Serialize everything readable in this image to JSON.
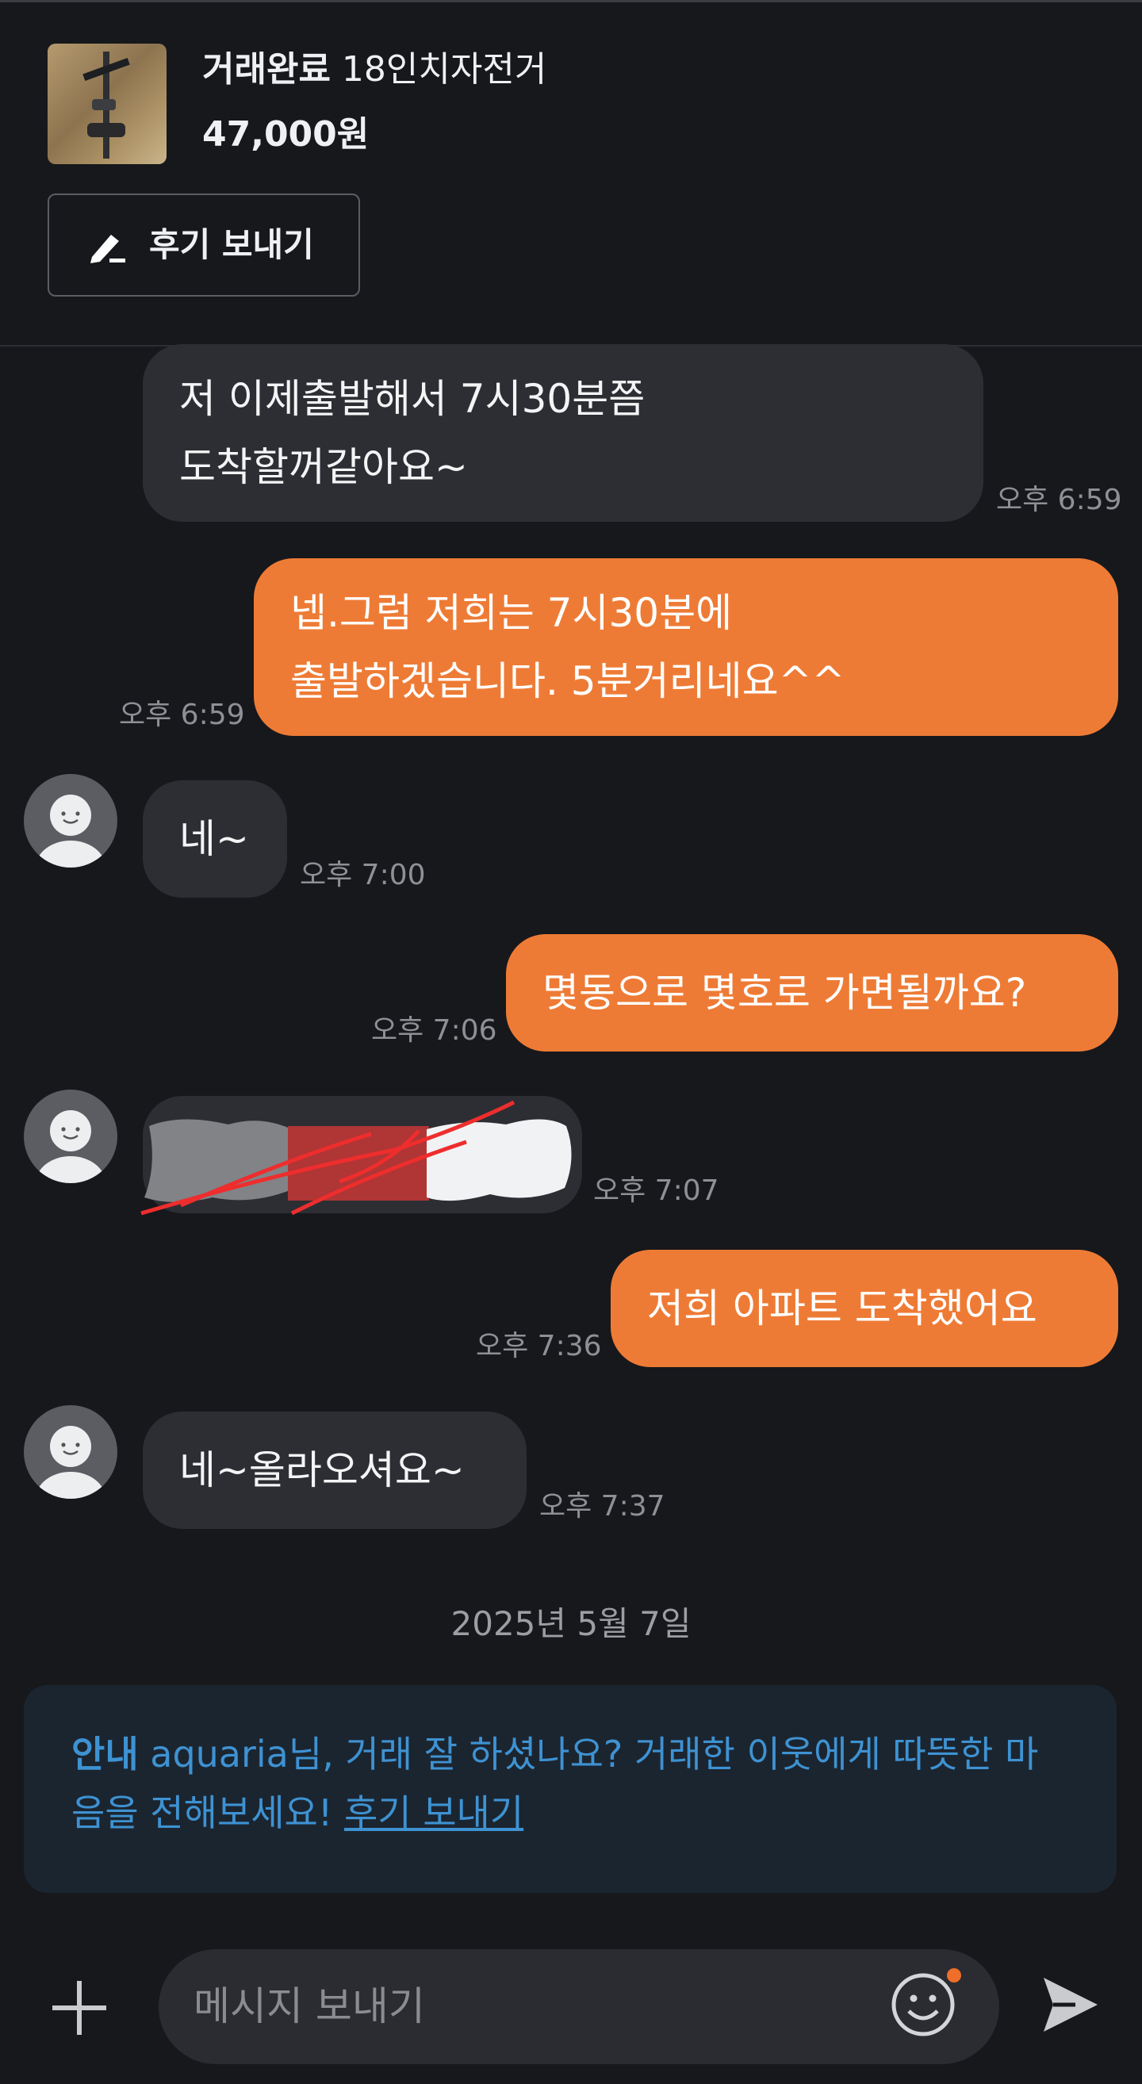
{
  "product": {
    "status": "거래완료",
    "name": "18인치자전거",
    "price": "47,000원",
    "review_button": "후기 보내기"
  },
  "messages": [
    {
      "side": "in",
      "lines": [
        "저 이제출발해서 7시30분쯤",
        "도착할꺼같아요~"
      ],
      "time": "오후 6:59"
    },
    {
      "side": "out",
      "lines": [
        "넵.그럼 저희는 7시30분에",
        "출발하겠습니다. 5분거리네요^^"
      ],
      "time": "오후 6:59"
    },
    {
      "side": "in",
      "lines": [
        "네~"
      ],
      "time": "오후 7:00"
    },
    {
      "side": "out",
      "lines": [
        "몇동으로 몇호로 가면될까요?"
      ],
      "time": "오후 7:06"
    },
    {
      "side": "in",
      "redacted": true,
      "time": "오후 7:07"
    },
    {
      "side": "out",
      "lines": [
        "저희 아파트 도착했어요"
      ],
      "time": "오후 7:36"
    },
    {
      "side": "in",
      "lines": [
        "네~올라오셔요~"
      ],
      "time": "오후 7:37"
    }
  ],
  "date_divider": "2025년 5월 7일",
  "notice": {
    "label": "안내",
    "text": " aquaria님, 거래 잘 하셨나요? 거래한 이웃에게 따뜻한 마음을 전해보세요! ",
    "link": "후기 보내기"
  },
  "input": {
    "placeholder": "메시지 보내기"
  },
  "colors": {
    "background": "#17181c",
    "incoming_bubble": "#2d2e33",
    "outgoing_bubble": "#ee7b35",
    "notice_text": "#3e92d2",
    "notice_background": "#1b2530"
  },
  "icons": [
    "pencil-icon",
    "avatar-icon",
    "plus-icon",
    "emoji-icon",
    "send-icon"
  ]
}
